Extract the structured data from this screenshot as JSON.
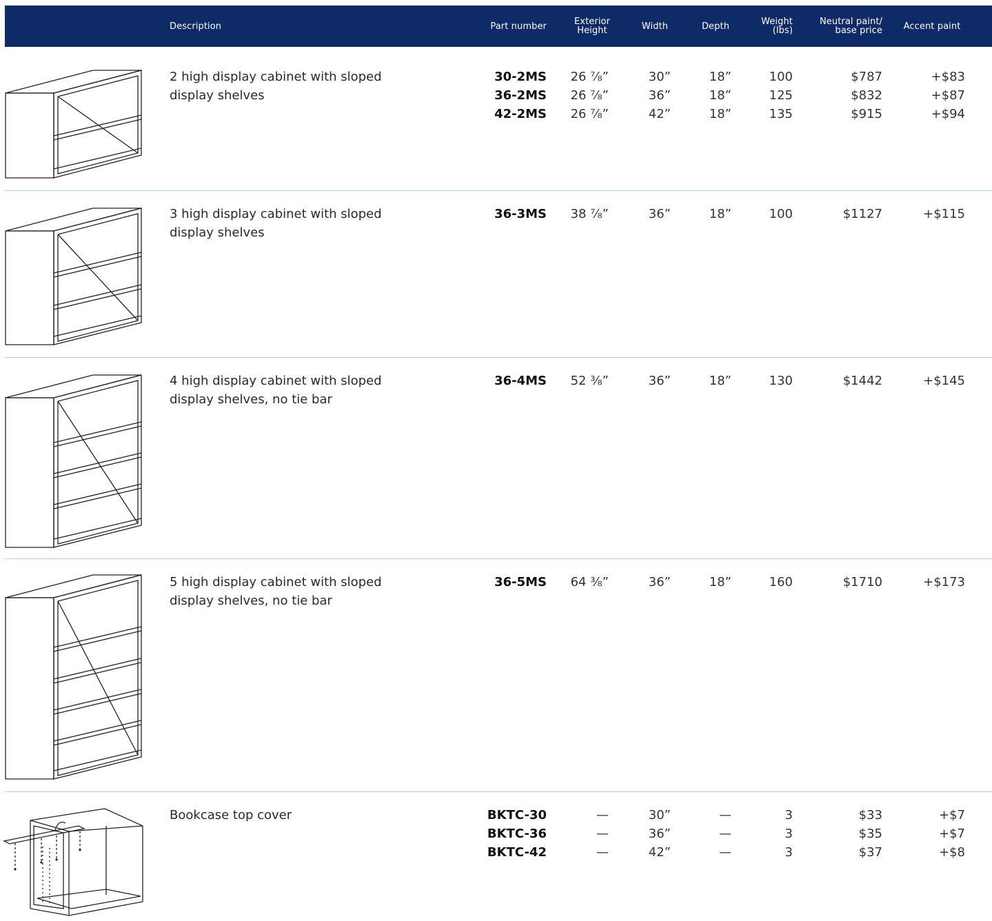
{
  "header": {
    "description": "Description",
    "part_number": "Part number",
    "exterior_height": "Exterior\nHeight",
    "width": "Width",
    "depth": "Depth",
    "weight": "Weight\n(lbs)",
    "neutral_price": "Neutral paint/\nbase price",
    "accent": "Accent paint"
  },
  "rows": [
    {
      "description": "2 high display cabinet with sloped display shelves",
      "icon": "2-shelf-display-cabinet-icon",
      "parts": [
        "30-2MS",
        "36-2MS",
        "42-2MS"
      ],
      "heights": [
        "26 ⅞”",
        "26 ⅞”",
        "26 ⅞”"
      ],
      "widths": [
        "30”",
        "36”",
        "42”"
      ],
      "depths": [
        "18”",
        "18”",
        "18”"
      ],
      "weights": [
        "100",
        "125",
        "135"
      ],
      "prices": [
        "$787",
        "$832",
        "$915"
      ],
      "accents": [
        "+$83",
        "+$87",
        "+$94"
      ]
    },
    {
      "description": "3 high display cabinet with sloped display shelves",
      "icon": "3-shelf-display-cabinet-icon",
      "parts": [
        "36-3MS"
      ],
      "heights": [
        "38 ⅞”"
      ],
      "widths": [
        "36”"
      ],
      "depths": [
        "18”"
      ],
      "weights": [
        "100"
      ],
      "prices": [
        "$1127"
      ],
      "accents": [
        "+$115"
      ]
    },
    {
      "description": "4 high display cabinet with sloped display shelves, no tie bar",
      "icon": "4-shelf-display-cabinet-icon",
      "parts": [
        "36-4MS"
      ],
      "heights": [
        "52 ⅜”"
      ],
      "widths": [
        "36”"
      ],
      "depths": [
        "18”"
      ],
      "weights": [
        "130"
      ],
      "prices": [
        "$1442"
      ],
      "accents": [
        "+$145"
      ]
    },
    {
      "description": "5 high display cabinet with sloped display shelves, no tie bar",
      "icon": "5-shelf-display-cabinet-icon",
      "parts": [
        "36-5MS"
      ],
      "heights": [
        "64 ⅜”"
      ],
      "widths": [
        "36”"
      ],
      "depths": [
        "18”"
      ],
      "weights": [
        "160"
      ],
      "prices": [
        "$1710"
      ],
      "accents": [
        "+$173"
      ]
    },
    {
      "description": "Bookcase top cover",
      "icon": "bookcase-top-cover-icon",
      "parts": [
        "BKTC-30",
        "BKTC-36",
        "BKTC-42"
      ],
      "heights": [
        "—",
        "—",
        "—"
      ],
      "widths": [
        "30”",
        "36”",
        "42”"
      ],
      "depths": [
        "—",
        "—",
        "—"
      ],
      "weights": [
        "3",
        "3",
        "3"
      ],
      "prices": [
        "$33",
        "$35",
        "$37"
      ],
      "accents": [
        "+$7",
        "+$7",
        "+$8"
      ]
    }
  ],
  "colors": {
    "header_bg": "#0e2b67",
    "divider": "#9fd6dc"
  }
}
